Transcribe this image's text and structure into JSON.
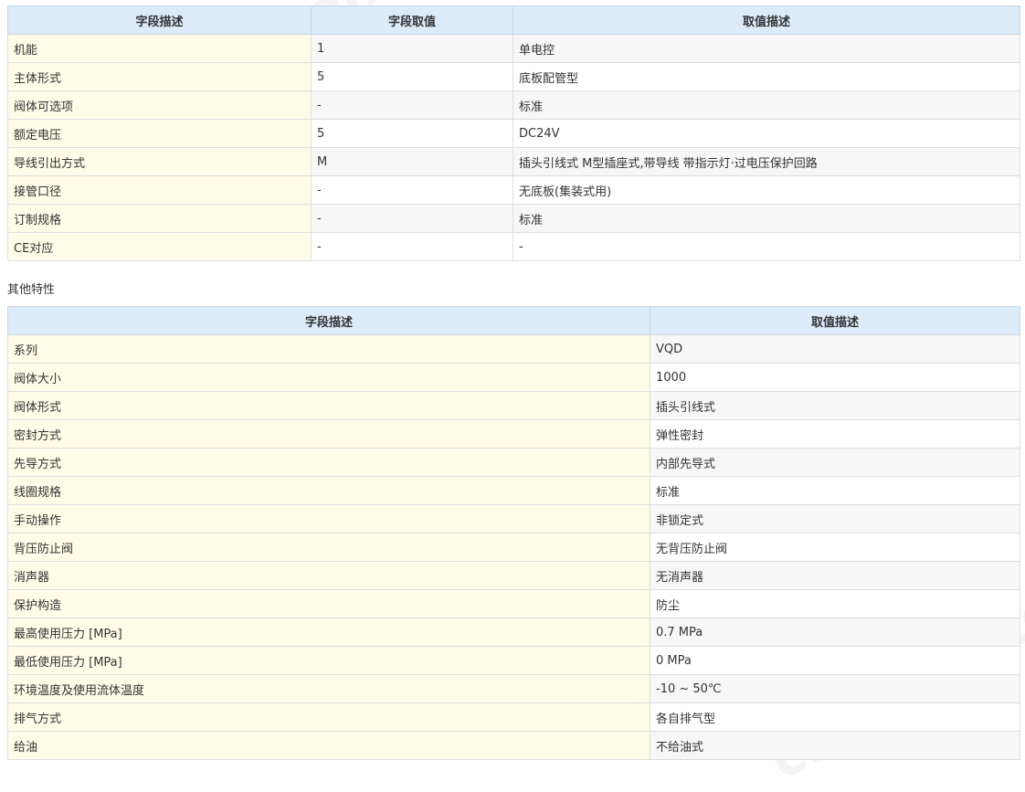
{
  "table1": {
    "headers": [
      "字段描述",
      "字段取值",
      "取值描述"
    ],
    "rows": [
      [
        "机能",
        "1",
        "单电控"
      ],
      [
        "主体形式",
        "5",
        "底板配管型"
      ],
      [
        "阀体可选项",
        "-",
        "标准"
      ],
      [
        "额定电压",
        "5",
        "DC24V"
      ],
      [
        "导线引出方式",
        "M",
        "插头引线式 M型插座式,带导线 带指示灯·过电压保护回路"
      ],
      [
        "接管口径",
        "-",
        "无底板(集装式用)"
      ],
      [
        "订制规格",
        "-",
        "标准"
      ],
      [
        "CE对应",
        "-",
        "-"
      ]
    ]
  },
  "section_title": "其他特性",
  "table2": {
    "headers": [
      "字段描述",
      "取值描述"
    ],
    "rows": [
      [
        "系列",
        "VQD"
      ],
      [
        "阀体大小",
        "1000"
      ],
      [
        "阀体形式",
        "插头引线式"
      ],
      [
        "密封方式",
        "弹性密封"
      ],
      [
        "先导方式",
        "内部先导式"
      ],
      [
        "线圈规格",
        "标准"
      ],
      [
        "手动操作",
        "非锁定式"
      ],
      [
        "背压防止阀",
        "无背压防止阀"
      ],
      [
        "消声器",
        "无消声器"
      ],
      [
        "保护构造",
        "防尘"
      ],
      [
        "最高使用压力 [MPa]",
        "0.7 MPa"
      ],
      [
        "最低使用压力 [MPa]",
        "0 MPa"
      ],
      [
        "环境温度及使用流体温度",
        "-10 ~ 50℃"
      ],
      [
        "排气方式",
        "各自排气型"
      ],
      [
        "给油",
        "不给油式"
      ]
    ]
  },
  "watermark": "chem17.com",
  "colors": {
    "header_bg": "#dcebf9",
    "name_cell_bg": "#fefbe6",
    "alt_row_bg": "#f7f7f7"
  }
}
